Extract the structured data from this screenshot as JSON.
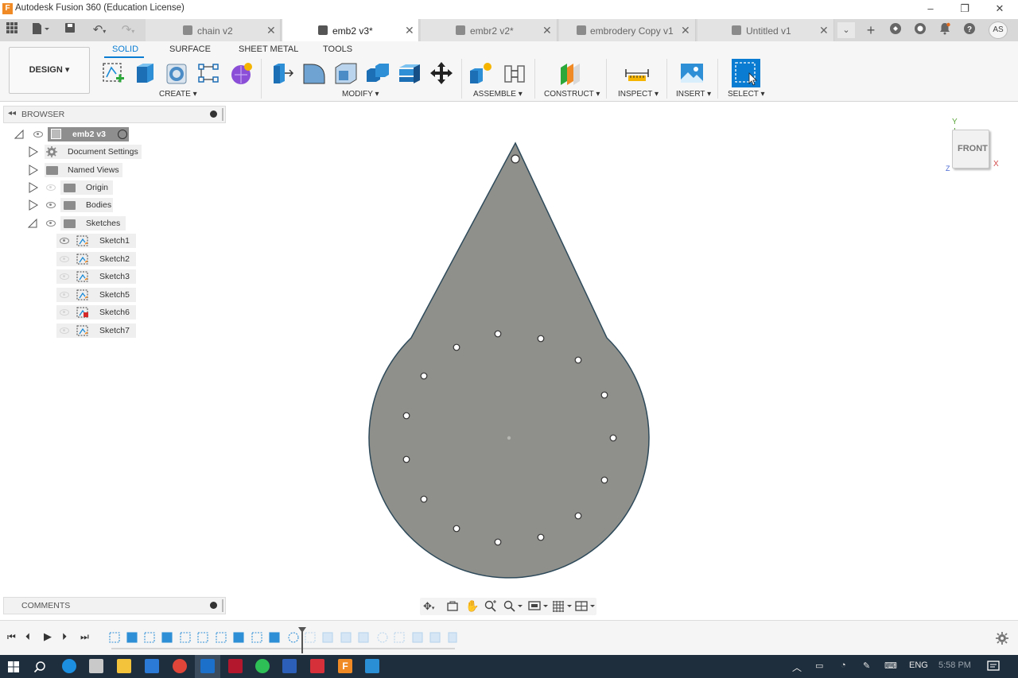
{
  "window": {
    "title": "Autodesk Fusion 360 (Education License)",
    "app_icon_letter": "F"
  },
  "tabs": [
    {
      "label": "chain v2",
      "active": false
    },
    {
      "label": "emb2 v3*",
      "active": true
    },
    {
      "label": "embr2 v2*",
      "active": false
    },
    {
      "label": "embrodery Copy v1",
      "active": false
    },
    {
      "label": "Untitled v1",
      "active": false
    }
  ],
  "user_initials": "AS",
  "workspace": {
    "label": "DESIGN"
  },
  "ribbon_tabs": [
    "SOLID",
    "SURFACE",
    "SHEET METAL",
    "TOOLS"
  ],
  "ribbon_groups": {
    "create": "CREATE",
    "modify": "MODIFY",
    "assemble": "ASSEMBLE",
    "construct": "CONSTRUCT",
    "inspect": "INSPECT",
    "insert": "INSERT",
    "select": "SELECT"
  },
  "browser": {
    "title": "BROWSER",
    "root": "emb2 v3",
    "items": [
      {
        "label": "Document Settings",
        "icon": "gear-icon"
      },
      {
        "label": "Named Views",
        "icon": "folder-icon"
      },
      {
        "label": "Origin",
        "icon": "folder-icon"
      },
      {
        "label": "Bodies",
        "icon": "folder-icon"
      },
      {
        "label": "Sketches",
        "icon": "folder-icon"
      }
    ],
    "sketches": [
      "Sketch1",
      "Sketch2",
      "Sketch3",
      "Sketch5",
      "Sketch6",
      "Sketch7"
    ]
  },
  "comments": {
    "title": "COMMENTS"
  },
  "viewcube": {
    "face": "FRONT",
    "axis_y": "Y",
    "axis_x": "X",
    "axis_z": "Z"
  },
  "taskbar": {
    "lang": "ENG",
    "time": "5:58 PM"
  },
  "colors": {
    "accent": "#0a7dd3",
    "body_fill": "#8f908c",
    "body_edge": "#2e4a5a",
    "taskbar": "#1f2e3c"
  }
}
